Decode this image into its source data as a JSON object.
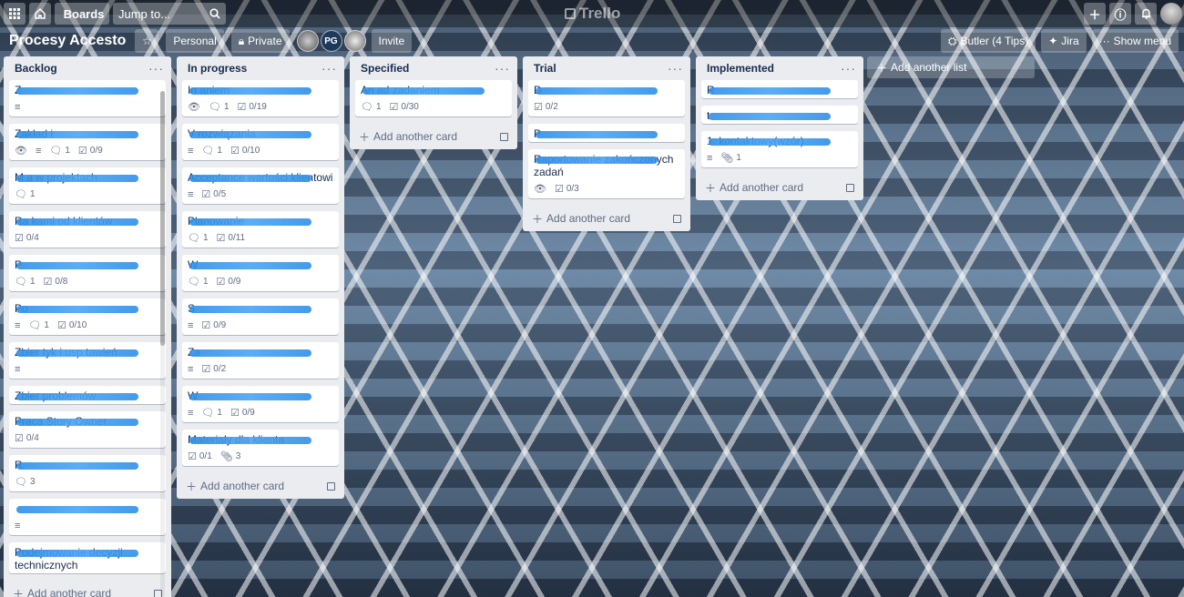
{
  "topbar": {
    "boards_label": "Boards",
    "search_placeholder": "Jump to...",
    "logo_text": "Trello"
  },
  "board": {
    "title": "Procesy Accesto",
    "team_label": "Personal",
    "visibility_label": "Private",
    "member_initials": "PG",
    "invite_label": "Invite",
    "butler_label": "Butler (4 Tips)",
    "jira_label": "Jira",
    "show_menu_label": "Show menu"
  },
  "add_card_label": "Add another card",
  "add_list_label": "Add another list",
  "lists": [
    {
      "title": "Backlog",
      "cards": [
        {
          "title": "Z",
          "badges": {
            "desc": true
          }
        },
        {
          "title": "Zakład                                        i",
          "badges": {
            "watch": true,
            "desc": true,
            "comments": "1",
            "checklist": "0/9"
          }
        },
        {
          "title": "M                                         a w projektach",
          "badges": {
            "comments": "1"
          }
        },
        {
          "title": "Ra                                    kami od klientów",
          "badges": {
            "checklist": "0/4"
          }
        },
        {
          "title": "P",
          "badges": {
            "comments": "1",
            "checklist": "0/8"
          }
        },
        {
          "title": "Po",
          "badges": {
            "desc": true,
            "comments": "1",
            "checklist": "0/10"
          }
        },
        {
          "title": "Zbier                          tyk i usp                                    tawień",
          "badges": {
            "desc": true
          }
        },
        {
          "title": "Zbier                                        problemów",
          "badges": {}
        },
        {
          "title": "Praca Story Owner",
          "badges": {
            "checklist": "0/4"
          }
        },
        {
          "title": "R",
          "badges": {
            "comments": "3"
          }
        },
        {
          "title": "",
          "badges": {
            "desc": true
          }
        },
        {
          "title": "Podejmowanie decyzji technicznych",
          "badges": {}
        }
      ]
    },
    {
      "title": "In progress",
      "cards": [
        {
          "title": "In                                                    aniem",
          "badges": {
            "watch": true,
            "comments": "1",
            "checklist": "0/19"
          }
        },
        {
          "title": "V                                          rozwiązania",
          "badges": {
            "desc": true,
            "comments": "1",
            "checklist": "0/10"
          }
        },
        {
          "title": "Acceptance                                    wartości klientowi",
          "badges": {
            "desc": true,
            "checklist": "0/5"
          }
        },
        {
          "title": "Planowanie",
          "badges": {
            "comments": "1",
            "checklist": "0/11"
          }
        },
        {
          "title": "W",
          "badges": {
            "comments": "1",
            "checklist": "0/9"
          }
        },
        {
          "title": "S",
          "badges": {
            "desc": true,
            "checklist": "0/9"
          }
        },
        {
          "title": "Za",
          "badges": {
            "desc": true,
            "checklist": "0/2"
          }
        },
        {
          "title": "W",
          "badges": {
            "desc": true,
            "comments": "1",
            "checklist": "0/9"
          }
        },
        {
          "title": "Materiały dla klienta",
          "badges": {
            "attachments": "3",
            "checklist": "0/1"
          }
        }
      ]
    },
    {
      "title": "Specified",
      "cards": [
        {
          "title": "An                                                ad zadaniem",
          "badges": {
            "comments": "1",
            "checklist": "0/30"
          }
        }
      ]
    },
    {
      "title": "Trial",
      "cards": [
        {
          "title": "D",
          "badges": {
            "checklist": "0/2"
          }
        },
        {
          "title": "P",
          "badges": {}
        },
        {
          "title": "Raportowanie zakończonych zadań",
          "badges": {
            "watch": true,
            "checklist": "0/3"
          }
        }
      ]
    },
    {
      "title": "Implemented",
      "cards": [
        {
          "title": "R",
          "badges": {}
        },
        {
          "title": "t",
          "badges": {}
        },
        {
          "title": "1.                                    kontaktowy(wzór)",
          "badges": {
            "desc": true,
            "attachments": "1"
          }
        }
      ]
    }
  ],
  "colors": {
    "list_bg": "#ebecf0",
    "card_bg": "#ffffff",
    "redaction": "#2f8fe8",
    "text": "#172b4d",
    "muted": "#5e6c84"
  }
}
